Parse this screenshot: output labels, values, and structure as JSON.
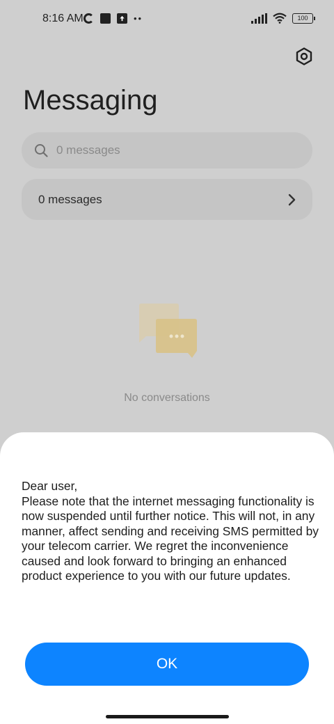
{
  "status_bar": {
    "time": "8:16 AM",
    "battery": "100"
  },
  "header": {
    "title": "Messaging",
    "settings_icon": "gear-hexagon-icon"
  },
  "search": {
    "placeholder": "0 messages"
  },
  "messages_row": {
    "label": "0 messages"
  },
  "empty_state": {
    "text": "No conversations"
  },
  "dialog": {
    "greeting": "Dear user,",
    "body": "Please note that the internet messaging functionality is now suspended until further notice. This will not, in any manner, affect sending and receiving SMS permitted by your telecom carrier. We regret the inconvenience caused and look forward to bringing an enhanced product experience to you with our future updates.",
    "ok_label": "OK"
  },
  "colors": {
    "accent": "#0d84ff",
    "overlay_background": "#cfcfcf",
    "sheet_background": "#ffffff"
  }
}
